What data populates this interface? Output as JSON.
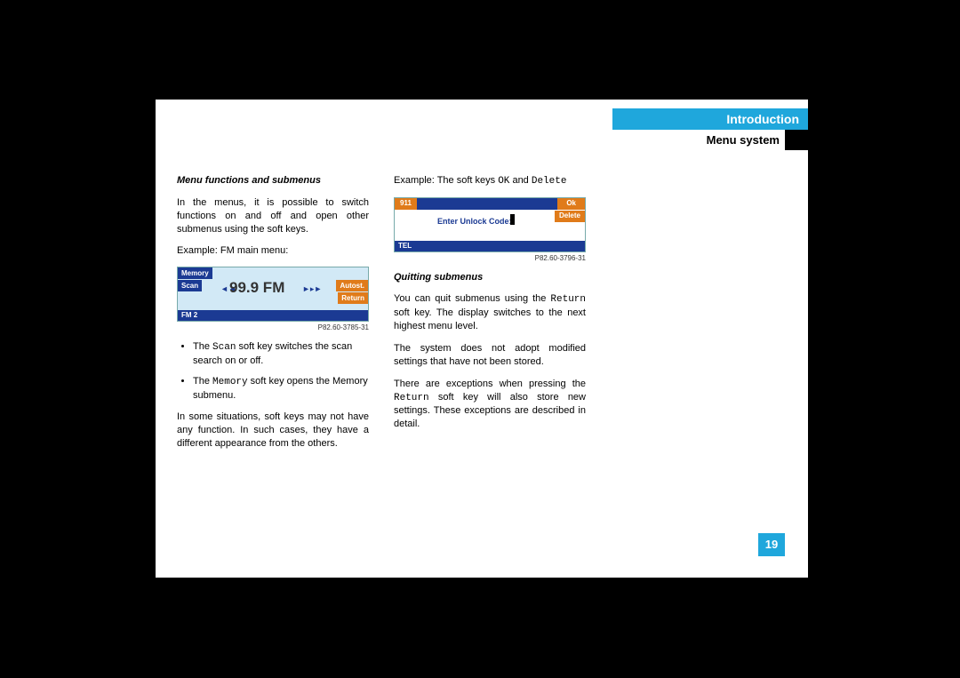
{
  "header": {
    "intro": "Introduction",
    "menu": "Menu system"
  },
  "col1": {
    "heading": "Menu functions and submenus",
    "p1": "In the menus, it is possible to switch functions on and off and open other submenus using the soft keys.",
    "p2": "Example: FM main menu:",
    "fm": {
      "memory": "Memory",
      "scan": "Scan",
      "freq": "99.9 FM",
      "autost": "Autost.",
      "ret": "Return",
      "status": "FM 2",
      "ref": "P82.60-3785-31"
    },
    "b1a": "The ",
    "b1b": "Scan",
    "b1c": " soft key switches the scan search on or off.",
    "b2a": "The ",
    "b2b": "Memory",
    "b2c": " soft key opens the Memory submenu.",
    "p3": "In some situations, soft keys may not have any function. In such cases, they have a different appearance from the others."
  },
  "col2": {
    "p1a": "Example: The soft keys ",
    "p1b": "OK",
    "p1c": " and ",
    "p1d": "Delete",
    "tel": {
      "emg": "911",
      "ok": "Ok",
      "del": "Delete",
      "prompt": "Enter Unlock Code:",
      "status": "TEL",
      "ref": "P82.60-3796-31"
    },
    "heading": "Quitting submenus",
    "p2a": "You can quit submenus using the ",
    "p2b": "Return",
    "p2c": " soft key. The display switches to the next highest menu level.",
    "p3": "The system does not adopt modified settings that have not been stored.",
    "p4a": "There are exceptions when pressing the ",
    "p4b": "Return",
    "p4c": " soft key will also store new settings. These exceptions are described in detail."
  },
  "pagenum": "19"
}
